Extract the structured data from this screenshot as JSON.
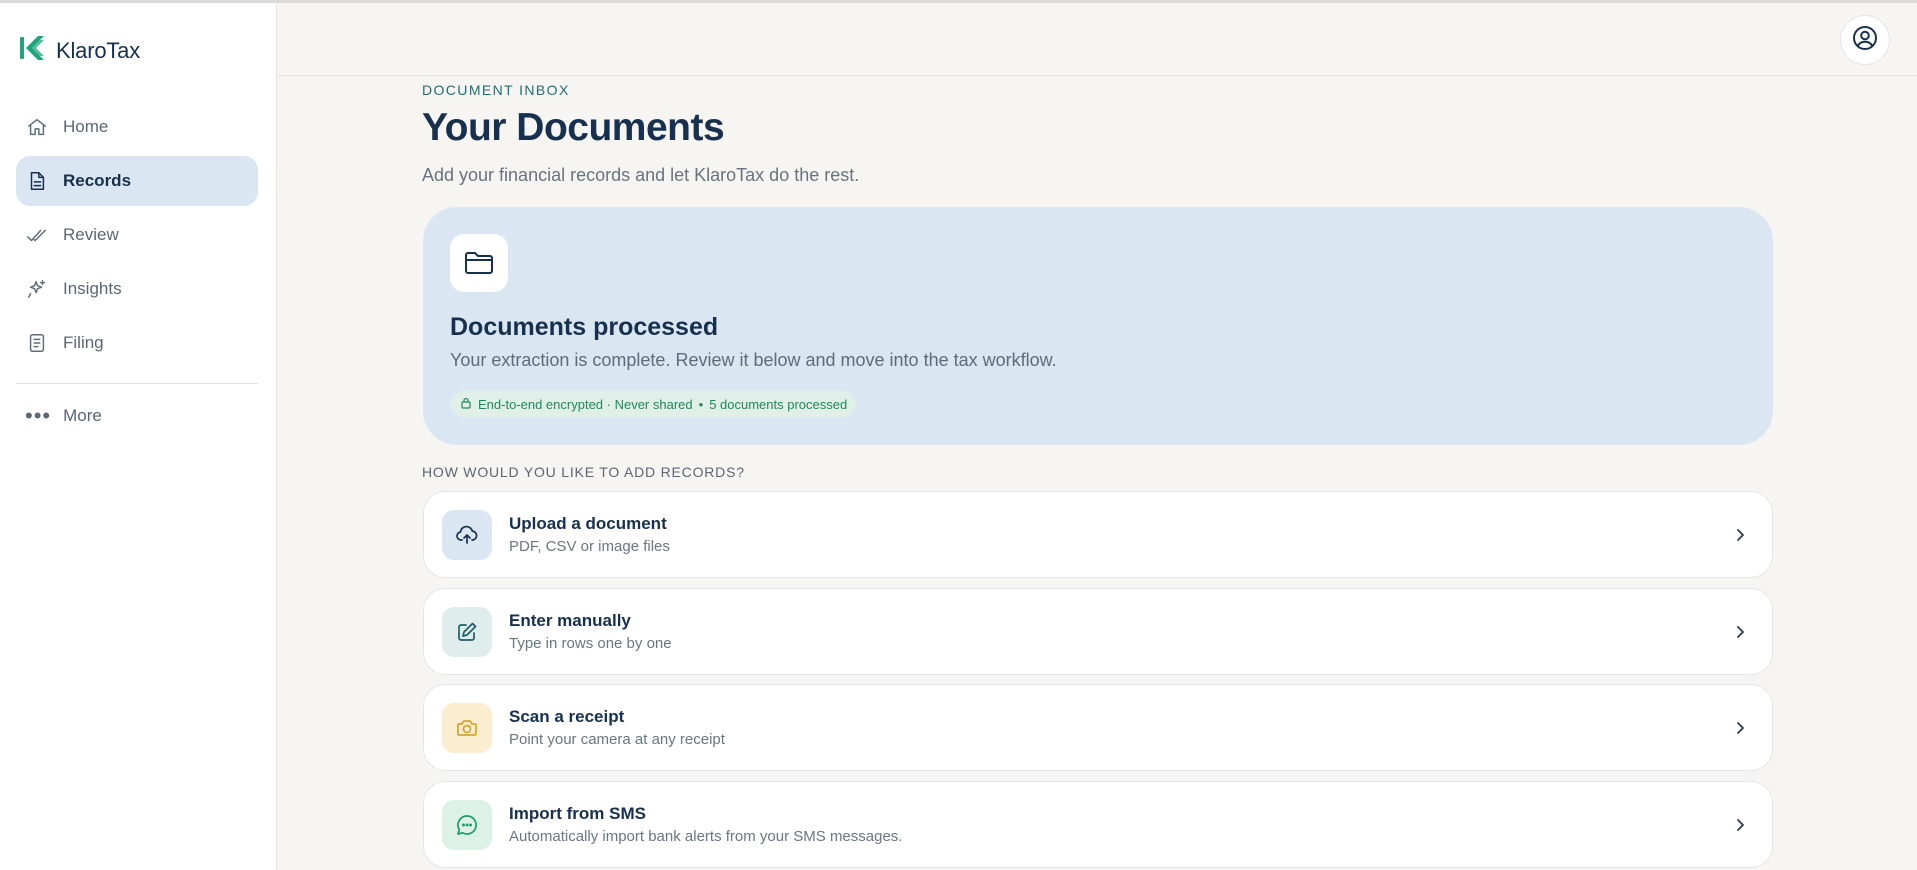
{
  "app": {
    "name": "KlaroTax"
  },
  "sidebar": {
    "items": [
      {
        "label": "Home",
        "icon": "home-icon",
        "active": false
      },
      {
        "label": "Records",
        "icon": "document-icon",
        "active": true
      },
      {
        "label": "Review",
        "icon": "double-check-icon",
        "active": false
      },
      {
        "label": "Insights",
        "icon": "sparkles-icon",
        "active": false
      },
      {
        "label": "Filing",
        "icon": "file-text-icon",
        "active": false
      }
    ],
    "more_label": "More"
  },
  "header": {
    "avatar_icon": "user-circle-icon"
  },
  "main": {
    "eyebrow": "DOCUMENT INBOX",
    "title": "Your Documents",
    "subtitle": "Add your financial records and let KlaroTax do the rest.",
    "hero": {
      "icon": "folder-icon",
      "title": "Documents processed",
      "text": "Your extraction is complete. Review it below and move into the tax workflow.",
      "badge_security": "End-to-end encrypted · Never shared",
      "badge_separator": "•",
      "badge_count": "5 documents processed"
    },
    "section_label": "HOW WOULD YOU LIKE TO ADD RECORDS?",
    "options": [
      {
        "title": "Upload a document",
        "subtitle": "PDF, CSV or image files",
        "icon": "cloud-upload-icon"
      },
      {
        "title": "Enter manually",
        "subtitle": "Type in rows one by one",
        "icon": "edit-icon"
      },
      {
        "title": "Scan a receipt",
        "subtitle": "Point your camera at any receipt",
        "icon": "camera-icon"
      },
      {
        "title": "Import from SMS",
        "subtitle": "Automatically import bank alerts from your SMS messages.",
        "icon": "message-icon"
      }
    ]
  },
  "colors": {
    "brand_green": "#1fa57a",
    "navy": "#16304d",
    "active_bg": "#dbe6f3",
    "badge_bg": "#e0efe7",
    "badge_text": "#1f8a5b"
  }
}
